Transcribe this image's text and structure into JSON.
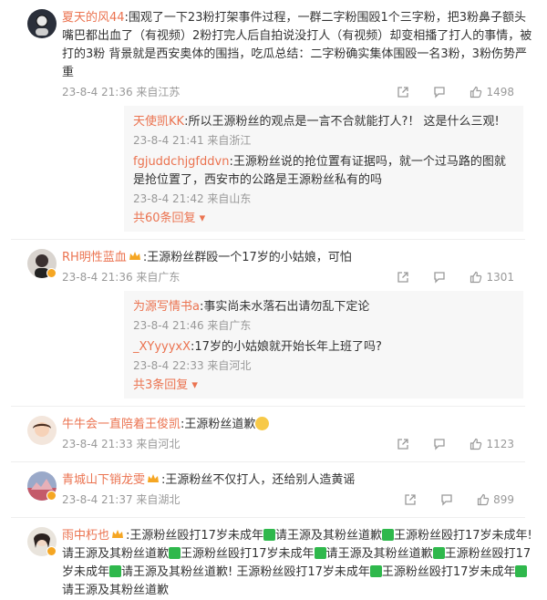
{
  "comments": [
    {
      "user": "夏天的风44",
      "text": ":围观了一下23粉打架事件过程，一群二字粉围殴1个三字粉，把3粉鼻子额头嘴巴都出血了（有视频）2粉打完人后自拍说没打人（有视频）却变相播了打人的事情，被打的3粉 背景就是西安奥体的围挡，吃瓜总结：二字粉确实集体围殴一名3粉，3粉伤势严重",
      "time": "23-8-4 21:36 来自江苏",
      "likes": "1498",
      "replies": [
        {
          "user": "天使凯KK",
          "text": ":所以王源粉丝的观点是一言不合就能打人?！ 这是什么三观!",
          "time": "23-8-4 21:41 来自浙江"
        },
        {
          "user": "fgjuddchjgfddvn",
          "text": ":王源粉丝说的抢位置有证据吗，就一个过马路的图就是抢位置了，西安市的公路是王源粉丝私有的吗",
          "time": "23-8-4 21:42 来自山东"
        }
      ],
      "more": "共60条回复"
    },
    {
      "user": "RH明性蓝血",
      "text": ":王源粉丝群殴一个17岁的小姑娘，可怕",
      "time": "23-8-4 21:36 来自广东",
      "likes": "1301",
      "replies": [
        {
          "user": "为源写情书a",
          "text": ":事实尚未水落石出请勿乱下定论",
          "time": "23-8-4 21:46 来自广东"
        },
        {
          "user": "_XYyyyxX",
          "text": ":17岁的小姑娘就开始长年上班了吗?",
          "time": "23-8-4 22:33 来自河北"
        }
      ],
      "more": "共3条回复"
    },
    {
      "user": "牛牛会一直陪着王俊凯",
      "text": ":王源粉丝道歉",
      "time": "23-8-4 21:33 来自河北",
      "likes": "1123"
    },
    {
      "user": "青城山下销龙雯",
      "text": ":王源粉丝不仅打人，还给别人造黄谣",
      "time": "23-8-4 21:37 来自湖北",
      "likes": "899"
    },
    {
      "user": "雨中朽也",
      "segments": [
        ":王源粉丝殴打17岁未成年",
        "请王源及其粉丝道歉",
        "王源粉丝殴打17岁未成年! 请王源及其粉丝道歉",
        "王源粉丝殴打17岁未成年",
        "请王源及其粉丝道歉",
        "王源粉丝殴打17岁未成年",
        "请王源及其粉丝道歉! 王源粉丝殴打17岁未成年",
        "王源粉丝殴打17岁未成年",
        "请王源及其粉丝道歉"
      ]
    }
  ],
  "colors": {
    "username": "#eb7350",
    "text": "#333333",
    "meta": "#999999",
    "reply_bg": "#f7f7f7",
    "green": "#2fb84c"
  },
  "icons": [
    "share-icon",
    "comment-icon",
    "like-icon",
    "crown-icon"
  ]
}
